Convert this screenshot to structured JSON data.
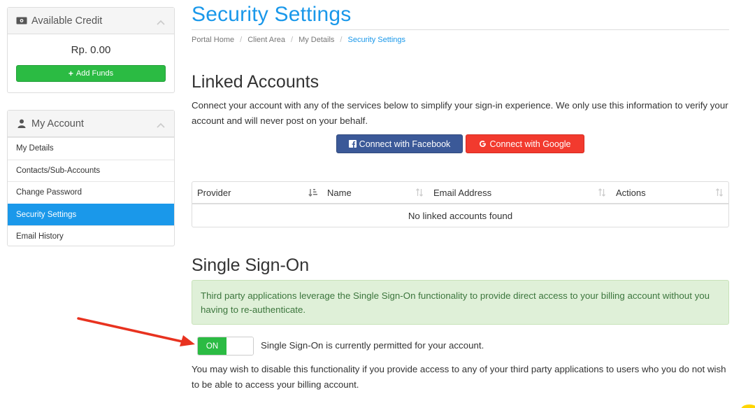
{
  "sidebar": {
    "credit_panel": {
      "title": "Available Credit",
      "amount": "Rp. 0.00",
      "add_funds_label": "Add Funds"
    },
    "account_panel": {
      "title": "My Account",
      "items": [
        {
          "label": "My Details",
          "active": false
        },
        {
          "label": "Contacts/Sub-Accounts",
          "active": false
        },
        {
          "label": "Change Password",
          "active": false
        },
        {
          "label": "Security Settings",
          "active": true
        },
        {
          "label": "Email History",
          "active": false
        }
      ]
    }
  },
  "main": {
    "title": "Security Settings",
    "breadcrumb": [
      "Portal Home",
      "Client Area",
      "My Details",
      "Security Settings"
    ],
    "linked_accounts": {
      "heading": "Linked Accounts",
      "description": "Connect your account with any of the services below to simplify your sign-in experience. We only use this information to verify your account and will never post on your behalf.",
      "facebook_button": "Connect with Facebook",
      "google_button": "Connect with Google",
      "table": {
        "columns": [
          "Provider",
          "Name",
          "Email Address",
          "Actions"
        ],
        "empty_text": "No linked accounts found"
      }
    },
    "sso": {
      "heading": "Single Sign-On",
      "info": "Third party applications leverage the Single Sign-On functionality to provide direct access to your billing account without you having to re-authenticate.",
      "toggle_label": "ON",
      "status_text": "Single Sign-On is currently permitted for your account.",
      "note": "You may wish to disable this functionality if you provide access to any of your third party applications to users who you do not wish to be able to access your billing account."
    }
  },
  "colors": {
    "accent": "#1a98ea",
    "success": "#2bbb43",
    "facebook": "#3b5998",
    "google": "#f23a2e",
    "alert_bg": "#dff0d8",
    "alert_text": "#3c763d",
    "annotation_arrow": "#e8321f"
  },
  "icons": [
    "money-icon",
    "chevron-up-icon",
    "plus-icon",
    "user-icon",
    "facebook-icon",
    "google-icon",
    "sort-icon",
    "arrow-annotation"
  ]
}
